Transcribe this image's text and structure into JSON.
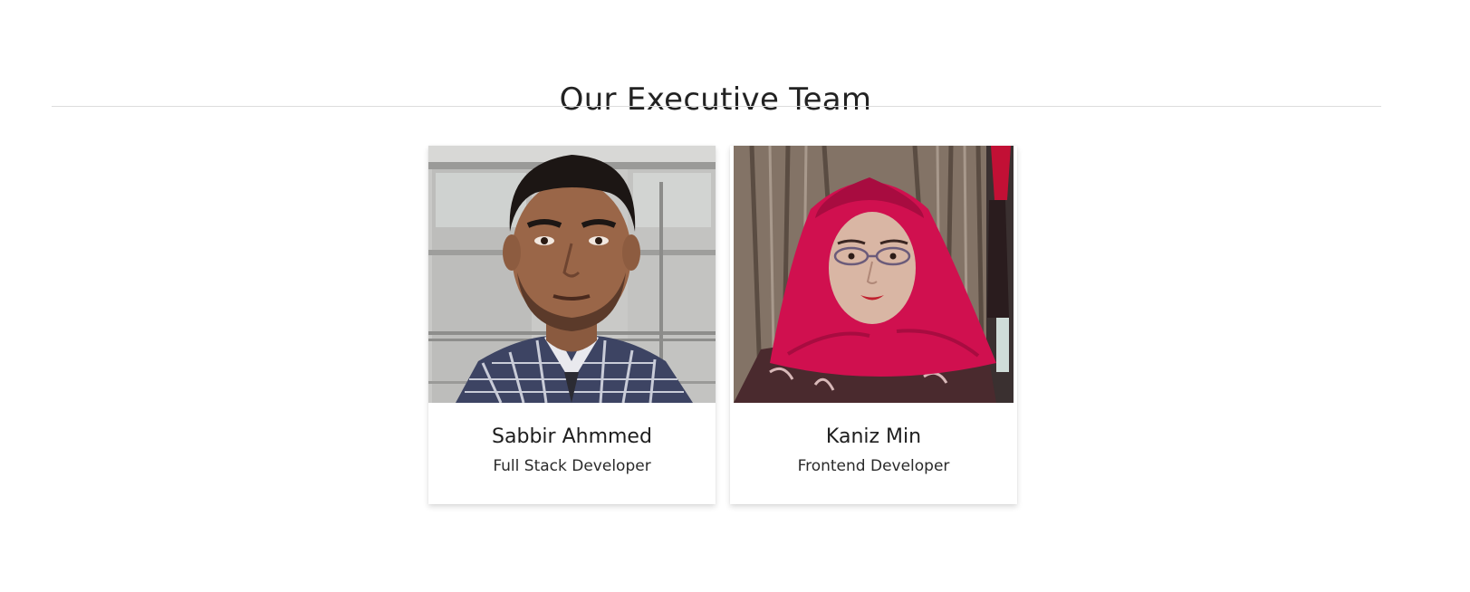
{
  "section": {
    "title": "Our Executive Team"
  },
  "members": [
    {
      "name": "Sabbir Ahmmed",
      "role": "Full Stack Developer",
      "photo": "portrait-photo"
    },
    {
      "name": "Kaniz Min",
      "role": "Frontend Developer",
      "photo": "portrait-photo"
    }
  ],
  "colors": {
    "divider": "#dcdcdc",
    "hijab": "#d0104f",
    "background": "#ffffff"
  }
}
